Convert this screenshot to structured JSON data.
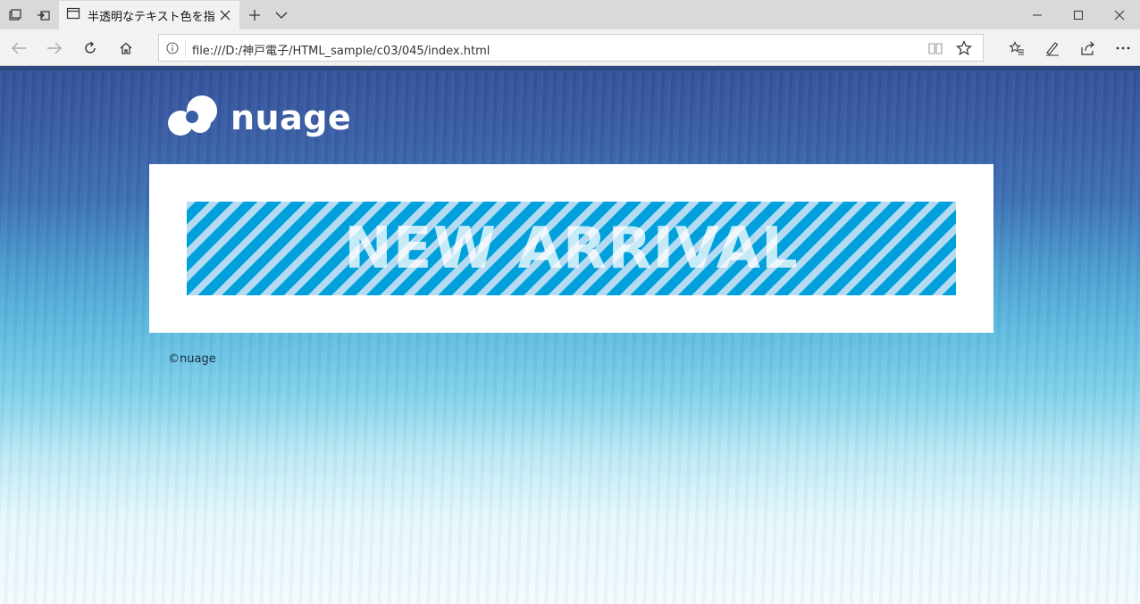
{
  "browser": {
    "tab": {
      "title": "半透明なテキスト色を指定"
    },
    "address": {
      "url": "file:///D:/神戸電子/HTML_sample/c03/045/index.html"
    },
    "icons": {
      "tab_actions": "tab-actions-icon",
      "tabs_aside": "tabs-aside-icon",
      "page_icon": "page-icon",
      "close": "close-icon",
      "new_tab": "plus-icon",
      "tab_list": "chevron-down-icon",
      "minimize": "minimize-icon",
      "maximize": "maximize-icon",
      "window_close": "close-icon",
      "back": "back-arrow-icon",
      "forward": "forward-arrow-icon",
      "refresh": "refresh-icon",
      "home": "home-icon",
      "info": "info-icon",
      "reading_view": "reading-view-icon",
      "favorite": "star-icon",
      "favorites": "favorites-icon",
      "notes": "pen-icon",
      "share": "share-icon",
      "more": "more-icon"
    }
  },
  "page": {
    "logo": {
      "text": "nuage"
    },
    "banner": {
      "text": "NEW ARRIVAL"
    },
    "footer": {
      "text": "©nuage"
    }
  },
  "colors": {
    "stripe_dark": "#00a0dc",
    "stripe_light": "#b4dbf1",
    "card_bg": "#ffffff",
    "bg_top": "#34529a",
    "bg_bottom": "#f3fbfe"
  }
}
